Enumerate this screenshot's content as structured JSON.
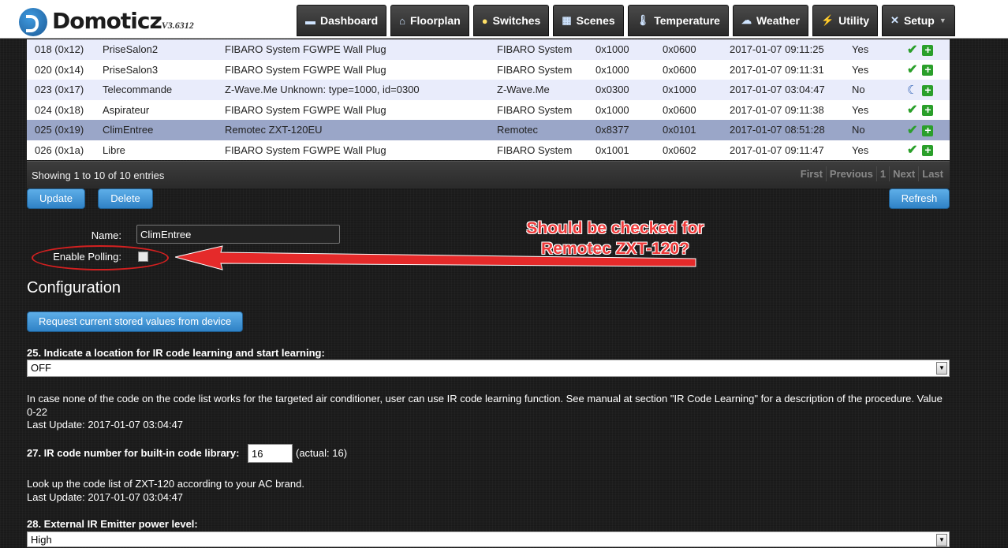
{
  "app": {
    "name": "Domoticz",
    "version": "V3.6312"
  },
  "nav": [
    {
      "label": "Dashboard",
      "icon": "monitor-icon"
    },
    {
      "label": "Floorplan",
      "icon": "house-icon"
    },
    {
      "label": "Switches",
      "icon": "bulb-icon"
    },
    {
      "label": "Scenes",
      "icon": "clapper-icon"
    },
    {
      "label": "Temperature",
      "icon": "thermometer-icon"
    },
    {
      "label": "Weather",
      "icon": "cloud-icon"
    },
    {
      "label": "Utility",
      "icon": "utility-icon"
    },
    {
      "label": "Setup",
      "icon": "tools-icon"
    }
  ],
  "table": {
    "rows": [
      {
        "node": "018 (0x12)",
        "name": "PriseSalon2",
        "desc": "FIBARO System FGWPE Wall Plug",
        "vendor": "FIBARO System",
        "type": "0x1000",
        "id": "0x0600",
        "last": "2017-01-07 09:11:25",
        "state": "Yes",
        "status_icon": "check-icon"
      },
      {
        "node": "020 (0x14)",
        "name": "PriseSalon3",
        "desc": "FIBARO System FGWPE Wall Plug",
        "vendor": "FIBARO System",
        "type": "0x1000",
        "id": "0x0600",
        "last": "2017-01-07 09:11:31",
        "state": "Yes",
        "status_icon": "check-icon"
      },
      {
        "node": "023 (0x17)",
        "name": "Telecommande",
        "desc": "Z-Wave.Me Unknown: type=1000, id=0300",
        "vendor": "Z-Wave.Me",
        "type": "0x0300",
        "id": "0x1000",
        "last": "2017-01-07 03:04:47",
        "state": "No",
        "status_icon": "moon-icon"
      },
      {
        "node": "024 (0x18)",
        "name": "Aspirateur",
        "desc": "FIBARO System FGWPE Wall Plug",
        "vendor": "FIBARO System",
        "type": "0x1000",
        "id": "0x0600",
        "last": "2017-01-07 09:11:38",
        "state": "Yes",
        "status_icon": "check-icon"
      },
      {
        "node": "025 (0x19)",
        "name": "ClimEntree",
        "desc": "Remotec ZXT-120EU",
        "vendor": "Remotec",
        "type": "0x8377",
        "id": "0x0101",
        "last": "2017-01-07 08:51:28",
        "state": "No",
        "status_icon": "check-icon"
      },
      {
        "node": "026 (0x1a)",
        "name": "Libre",
        "desc": "FIBARO System FGWPE Wall Plug",
        "vendor": "FIBARO System",
        "type": "0x1001",
        "id": "0x0602",
        "last": "2017-01-07 09:11:47",
        "state": "Yes",
        "status_icon": "check-icon"
      }
    ],
    "showing": "Showing 1 to 10 of 10 entries",
    "pager": [
      "First",
      "Previous",
      "1",
      "Next",
      "Last"
    ]
  },
  "buttons": {
    "update": "Update",
    "delete": "Delete",
    "refresh": "Refresh",
    "request": "Request current stored values from device"
  },
  "form": {
    "name_label": "Name:",
    "name_value": "ClimEntree",
    "polling_label": "Enable Polling:"
  },
  "annotation": {
    "line1": "Should be checked for",
    "line2": "Remotec ZXT-120?"
  },
  "config": {
    "title": "Configuration",
    "p25": {
      "title": "25. Indicate a location for IR code learning and start learning:",
      "value": "OFF",
      "desc": "In case none of the code on the code list works for the targeted air conditioner, user can use IR code learning function. See manual at section \"IR Code Learning\" for a description of the procedure. Value 0-22",
      "last": "Last Update: 2017-01-07 03:04:47"
    },
    "p27": {
      "title": "27. IR code number for built-in code library:",
      "value": "16",
      "actual": "(actual: 16)",
      "desc": "Look up the code list of ZXT-120 according to your AC brand.",
      "last": "Last Update: 2017-01-07 03:04:47"
    },
    "p28": {
      "title": "28. External IR Emitter power level:",
      "value": "High"
    }
  },
  "colors": {
    "accent_blue": "#2f82c6",
    "selected_row": "#9aa6c8",
    "annotation_red": "#ef3a3a"
  }
}
